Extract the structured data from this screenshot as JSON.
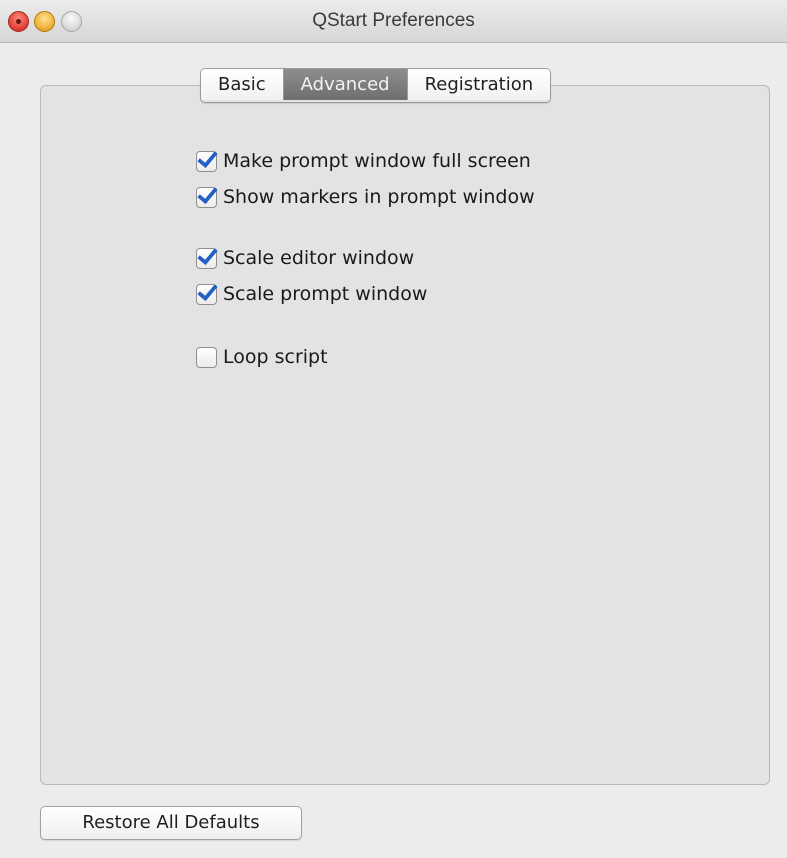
{
  "window": {
    "title": "QStart Preferences"
  },
  "tabs": [
    {
      "label": "Basic",
      "selected": false
    },
    {
      "label": "Advanced",
      "selected": true
    },
    {
      "label": "Registration",
      "selected": false
    }
  ],
  "options": [
    {
      "label": "Make prompt window full screen",
      "checked": true
    },
    {
      "label": "Show markers in prompt window",
      "checked": true
    },
    {
      "label": "Scale editor window",
      "checked": true
    },
    {
      "label": "Scale prompt window",
      "checked": true
    },
    {
      "label": "Loop script",
      "checked": false
    }
  ],
  "footer": {
    "restore_label": "Restore All Defaults"
  },
  "colors": {
    "checkmark": "#2461c4",
    "selected_tab": "#7a7a7a",
    "close_button": "#e3463b",
    "minimize_button": "#f0b43c"
  }
}
